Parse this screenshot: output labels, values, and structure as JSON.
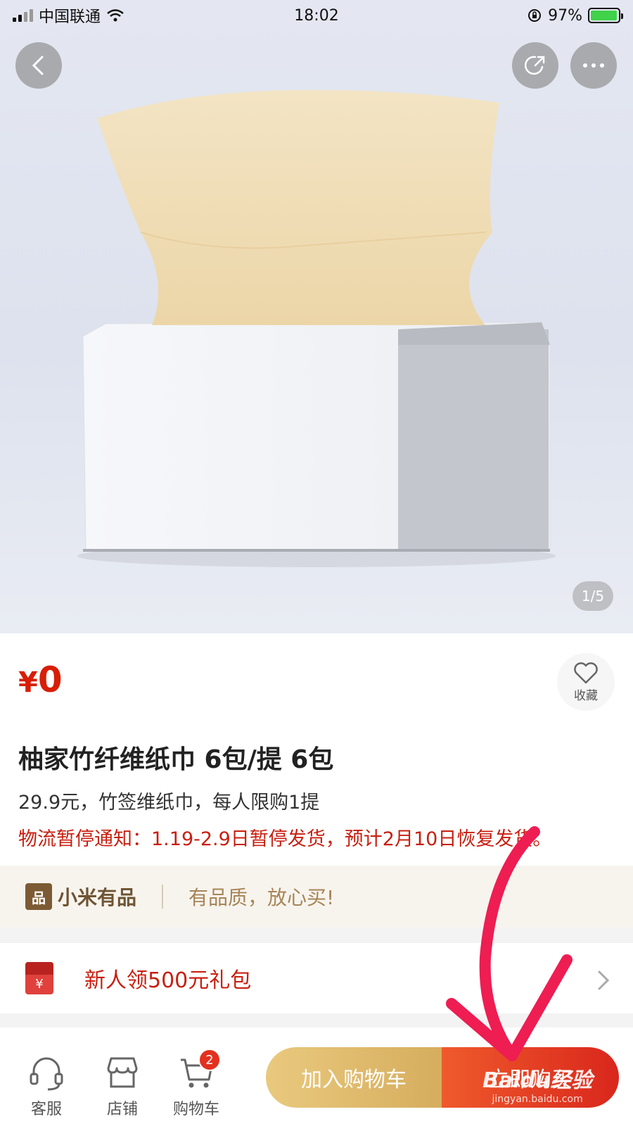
{
  "status_bar": {
    "carrier": "中国联通",
    "time": "18:02",
    "battery": "97%",
    "battery_level": 0.97
  },
  "hero": {
    "image_counter": "1/5"
  },
  "product": {
    "price_symbol": "¥",
    "price_value": "0",
    "favorite_label": "收藏",
    "title": "柚家竹纤维纸巾 6包/提 6包",
    "subtitle": "29.9元，竹签维纸巾，每人限购1提",
    "notice": "物流暂停通知：1.19-2.9日暂停发货，预计2月10日恢复发货。"
  },
  "brand_bar": {
    "logo_glyph": "品",
    "name": "小米有品",
    "slogan": "有品质，放心买!"
  },
  "gift_row": {
    "icon_glyph": "¥",
    "text": "新人领500元礼包"
  },
  "bottom_bar": {
    "tabs": [
      {
        "label": "客服"
      },
      {
        "label": "店铺"
      },
      {
        "label": "购物车"
      }
    ],
    "cart_badge": "2",
    "add_to_cart_label": "加入购物车",
    "buy_now_label": "立即购买"
  },
  "watermark": {
    "brand": "Baidu经验",
    "url": "jingyan.baidu.com"
  },
  "colors": {
    "price_red": "#d81e06",
    "notice_red": "#c81f10",
    "add_cart_gold": "#d6ad5e",
    "buy_now_red": "#d9271c",
    "annotation_pink": "#ee1d52"
  }
}
